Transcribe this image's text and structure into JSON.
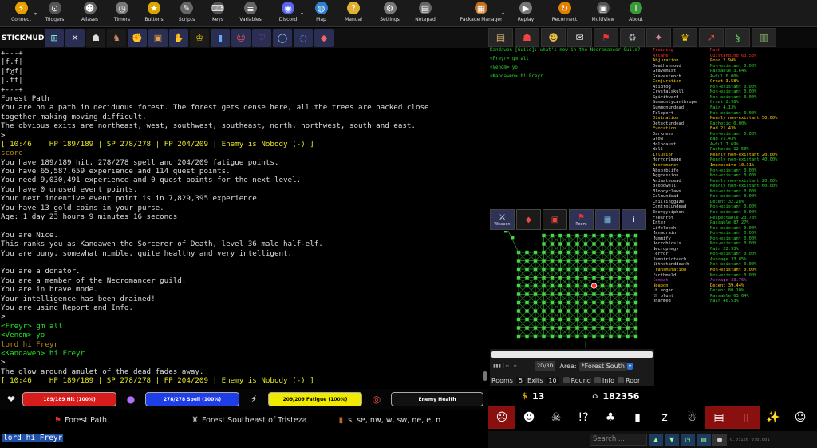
{
  "toolbar": {
    "items": [
      {
        "name": "connect",
        "label": "Connect",
        "glyph": "⚡",
        "color": "#e8a000",
        "arrow": true
      },
      {
        "name": "triggers",
        "label": "Triggers",
        "glyph": "⊙",
        "color": "#555"
      },
      {
        "name": "aliases",
        "label": "Aliases",
        "glyph": "☻",
        "color": "#666"
      },
      {
        "name": "timers",
        "label": "Timers",
        "glyph": "◷",
        "color": "#777"
      },
      {
        "name": "buttons",
        "label": "Buttons",
        "glyph": "★",
        "color": "#d8a800"
      },
      {
        "name": "scripts",
        "label": "Scripts",
        "glyph": "✎",
        "color": "#666"
      },
      {
        "name": "keys",
        "label": "Keys",
        "glyph": "⌨",
        "color": "#555"
      },
      {
        "name": "variables",
        "label": "Variables",
        "glyph": "≣",
        "color": "#666"
      },
      {
        "name": "discord",
        "label": "Discord",
        "glyph": "◉",
        "color": "#5865f2",
        "arrow": true
      },
      {
        "name": "map",
        "label": "Map",
        "glyph": "◍",
        "color": "#2d7fd0"
      },
      {
        "name": "manual",
        "label": "Manual",
        "glyph": "?",
        "color": "#e0b030"
      },
      {
        "name": "settings",
        "label": "Settings",
        "glyph": "⚙",
        "color": "#777"
      },
      {
        "name": "notepad",
        "label": "Notepad",
        "glyph": "▤",
        "color": "#666"
      },
      {
        "name": "package-manager",
        "label": "Package Manager",
        "glyph": "▦",
        "color": "#c07020",
        "arrow": true
      },
      {
        "name": "replay",
        "label": "Replay",
        "glyph": "▶",
        "color": "#777"
      },
      {
        "name": "reconnect",
        "label": "Reconnect",
        "glyph": "↻",
        "color": "#e08000"
      },
      {
        "name": "multiview",
        "label": "MultiView",
        "glyph": "▣",
        "color": "#555"
      },
      {
        "name": "about",
        "label": "About",
        "glyph": "i",
        "color": "#3a9a3a"
      }
    ]
  },
  "mud_name": "STICKMUD",
  "quick_icons": [
    {
      "name": "world-icon",
      "glyph": "⊞",
      "alt": false
    },
    {
      "name": "skills-icon",
      "glyph": "✕",
      "alt": false
    },
    {
      "name": "guild-icon",
      "glyph": "☗",
      "alt": true
    },
    {
      "name": "boots-icon",
      "glyph": "♞",
      "alt": true
    },
    {
      "name": "strength-icon",
      "glyph": "✊",
      "alt": false
    },
    {
      "name": "armor-icon",
      "glyph": "▣",
      "alt": false
    },
    {
      "name": "gloves-icon",
      "glyph": "✋",
      "alt": false
    },
    {
      "name": "crown-icon",
      "glyph": "♔",
      "alt": true
    },
    {
      "name": "legs-icon",
      "glyph": "▮",
      "alt": false
    },
    {
      "name": "mask-icon",
      "glyph": "☺",
      "alt": false
    },
    {
      "name": "amulet-icon",
      "glyph": "♡",
      "alt": false
    },
    {
      "name": "ring-icon",
      "glyph": "◯",
      "alt": false
    },
    {
      "name": "ring2-icon",
      "glyph": "◌",
      "alt": false
    },
    {
      "name": "shield-icon",
      "glyph": "◆",
      "alt": false
    }
  ],
  "console": {
    "lines": [
      {
        "t": "+---+",
        "c": "white"
      },
      {
        "t": "|f.f|",
        "c": "white"
      },
      {
        "t": "|f@f|",
        "c": "white"
      },
      {
        "t": "|.ff|",
        "c": "white"
      },
      {
        "t": "+---+",
        "c": "white"
      },
      {
        "t": "Forest Path",
        "c": "white"
      },
      {
        "t": "You are on a path in deciduous forest. The forest gets dense here, all the trees are packed close",
        "c": "white"
      },
      {
        "t": "together making moving difficult.",
        "c": "white"
      },
      {
        "t": "The obvious exits are northeast, west, southwest, southeast, north, northwest, south and east.",
        "c": "white"
      },
      {
        "t": ">",
        "c": "white"
      },
      {
        "t": "[ 10:46    HP 189/189 | SP 278/278 | FP 204/209 | Enemy is Nobody (-) ]",
        "c": "yellow"
      },
      {
        "t": "score",
        "c": "olive"
      },
      {
        "t": "You have 189/189 hit, 278/278 spell and 204/209 fatigue points.",
        "c": "white"
      },
      {
        "t": "You have 65,587,659 experience and 114 quest points.",
        "c": "white"
      },
      {
        "t": "You need 9,030,491 experience and 0 quest points for the next level.",
        "c": "white"
      },
      {
        "t": "You have 0 unused event points.",
        "c": "white"
      },
      {
        "t": "Your next incentive event point is in 7,829,395 experience.",
        "c": "white"
      },
      {
        "t": "You have 13 gold coins in your purse.",
        "c": "white"
      },
      {
        "t": "Age: 1 day 23 hours 9 minutes 16 seconds",
        "c": "white"
      },
      {
        "t": "",
        "c": "white"
      },
      {
        "t": "You are Nice.",
        "c": "white"
      },
      {
        "t": "This ranks you as Kandawen the Sorcerer of Death, level 36 male half-elf.",
        "c": "white"
      },
      {
        "t": "You are puny, somewhat nimble, quite healthy and very intelligent.",
        "c": "white"
      },
      {
        "t": "",
        "c": "white"
      },
      {
        "t": "You are a donator.",
        "c": "white"
      },
      {
        "t": "You are a member of the Necromancer guild.",
        "c": "white"
      },
      {
        "t": "You are in brave mode.",
        "c": "white"
      },
      {
        "t": "Your intelligence has been drained!",
        "c": "white"
      },
      {
        "t": "You are using Report and Info.",
        "c": "white"
      },
      {
        "t": ">",
        "c": "white"
      },
      {
        "t": "<Freyr> gm all",
        "c": "green"
      },
      {
        "t": "<Venom> yo",
        "c": "green"
      },
      {
        "t": "lord hi Freyr",
        "c": "olive"
      },
      {
        "t": "<Kandawen> hi Freyr",
        "c": "green"
      },
      {
        "t": ">",
        "c": "white"
      },
      {
        "t": "The glow around amulet of the dead fades away.",
        "c": "white"
      },
      {
        "t": "[ 10:46    HP 189/189 | SP 278/278 | FP 204/209 | Enemy is Nobody (-) ]",
        "c": "yellow"
      }
    ]
  },
  "gauges": {
    "hp": {
      "label": "189/189 Hit (100%)",
      "color": "#d81b1b",
      "fill": 1.0
    },
    "sp": {
      "label": "278/278 Spell (100%)",
      "color": "#1e3ee8",
      "fill": 1.0
    },
    "fp": {
      "label": "209/209 Fatigue (100%)",
      "color": "#f0ea00",
      "fill": 1.0
    },
    "enemy": {
      "label": "Enemy Health",
      "color": "#1a1a1a",
      "fill": 0
    }
  },
  "room_info": {
    "room": "Forest Path",
    "area": "Forest Southeast of Tristeza",
    "exits": "s, se, nw, w, sw, ne, e, n"
  },
  "command_input": "lord hi Freyr",
  "right_tabs": [
    {
      "name": "scroll-icon",
      "glyph": "▤"
    },
    {
      "name": "group-icon",
      "glyph": "☗"
    },
    {
      "name": "people-icon",
      "glyph": "☻"
    },
    {
      "name": "chat-icon",
      "glyph": "✉"
    },
    {
      "name": "pin-icon",
      "glyph": "⚑"
    },
    {
      "name": "trash-icon",
      "glyph": "♻"
    },
    {
      "name": "wizard-icon",
      "glyph": "✦"
    },
    {
      "name": "trophy-icon",
      "glyph": "♛"
    },
    {
      "name": "graph-icon",
      "glyph": "↗"
    },
    {
      "name": "snake-icon",
      "glyph": "§"
    },
    {
      "name": "books-icon",
      "glyph": "▥"
    }
  ],
  "chat": {
    "lines": [
      "Kandawen [Guild]: what's new in the Necromancer Guild?",
      "<Freyr> gm all",
      "<Venom> yo",
      "<Kandawen> hi Freyr"
    ]
  },
  "skills": {
    "rows": [
      {
        "n": "Training",
        "v": "Rank",
        "nc": "#ff3030",
        "vc": "#ff3030"
      },
      {
        "n": "Arcane",
        "v": "Outstanding 63.58%",
        "nc": "#ff3030",
        "vc": "#ff3030"
      },
      {
        "n": " Abjuration",
        "v": "Poor 2.94%",
        "nc": "#ffd200",
        "vc": "#ffd200"
      },
      {
        "n": "  Deathshroud",
        "v": "Non-existant 0.00%",
        "nc": "#ddd",
        "vc": "#2fd22f"
      },
      {
        "n": "  Gravemist",
        "v": "Passable 3.64%",
        "nc": "#ddd",
        "vc": "#2fd22f"
      },
      {
        "n": "  Gravestench",
        "v": "Awful 0.00%",
        "nc": "#ddd",
        "vc": "#2fd22f"
      },
      {
        "n": " Conjuration",
        "v": "Great 3.58%",
        "nc": "#ffd200",
        "vc": "#ffd200"
      },
      {
        "n": "  Acidfog",
        "v": "Non-existant 0.00%",
        "nc": "#ddd",
        "vc": "#2fd22f"
      },
      {
        "n": "  Crystalskull",
        "v": "Non-existant 0.00%",
        "nc": "#ddd",
        "vc": "#2fd22f"
      },
      {
        "n": "  Spiritward",
        "v": "Non-existant 0.00%",
        "nc": "#ddd",
        "vc": "#2fd22f"
      },
      {
        "n": "  Summonlycanthrope",
        "v": "Great 2.98%",
        "nc": "#ddd",
        "vc": "#2fd22f"
      },
      {
        "n": "  Summonundead",
        "v": "Fair 4.13%",
        "nc": "#ddd",
        "vc": "#2fd22f"
      },
      {
        "n": "  Teleport",
        "v": "Non-existant 0.00%",
        "nc": "#ddd",
        "vc": "#2fd22f"
      },
      {
        "n": " Divination",
        "v": "Nearly non-existant 50.00%",
        "nc": "#ffd200",
        "vc": "#ffd200"
      },
      {
        "n": "  Detectundead",
        "v": "Pathetic 0.00%",
        "nc": "#ddd",
        "vc": "#2fd22f"
      },
      {
        "n": " Evocation",
        "v": "Bad 21.43%",
        "nc": "#ffd200",
        "vc": "#ffd200"
      },
      {
        "n": "  Darkness",
        "v": "Non-existant 0.00%",
        "nc": "#ddd",
        "vc": "#2fd22f"
      },
      {
        "n": "  Glow",
        "v": "Bad 71.43%",
        "nc": "#ddd",
        "vc": "#2fd22f"
      },
      {
        "n": "  Holocaust",
        "v": "Awful 7.69%",
        "nc": "#ddd",
        "vc": "#2fd22f"
      },
      {
        "n": "  Wall",
        "v": "Pathetic 12.50%",
        "nc": "#ddd",
        "vc": "#2fd22f"
      },
      {
        "n": " Illusion",
        "v": "Nearly non-existant 20.00%",
        "nc": "#ffd200",
        "vc": "#ffd200"
      },
      {
        "n": "  Horrorimage",
        "v": "Nearly non-existant 40.00%",
        "nc": "#ddd",
        "vc": "#2fd22f"
      },
      {
        "n": " Necromancy",
        "v": "Impressive 10.31%",
        "nc": "#ffd200",
        "vc": "#ffd200"
      },
      {
        "n": "  Absorblife",
        "v": "Non-existant 0.00%",
        "nc": "#ddd",
        "vc": "#2fd22f"
      },
      {
        "n": "  Aggression",
        "v": "Non-existant 0.00%",
        "nc": "#ddd",
        "vc": "#2fd22f"
      },
      {
        "n": "  Animatedead",
        "v": "Nearly non-existant 20.00%",
        "nc": "#ddd",
        "vc": "#2fd22f"
      },
      {
        "n": "  Bloodwell",
        "v": "Nearly non-existant 60.00%",
        "nc": "#ddd",
        "vc": "#2fd22f"
      },
      {
        "n": "  Bloodyclaws",
        "v": "Non-existant 0.00%",
        "nc": "#ddd",
        "vc": "#2fd22f"
      },
      {
        "n": "  Calmundead",
        "v": "Non-existant 0.00%",
        "nc": "#ddd",
        "vc": "#2fd22f"
      },
      {
        "n": "  Chillinggaze",
        "v": "Decent 32.28%",
        "nc": "#ddd",
        "vc": "#2fd22f"
      },
      {
        "n": "  Controlundead",
        "v": "Non-existant 0.00%",
        "nc": "#ddd",
        "vc": "#2fd22f"
      },
      {
        "n": "  Energysiphon",
        "v": "Non-existant 0.00%",
        "nc": "#ddd",
        "vc": "#2fd22f"
      },
      {
        "n": "  Fleshrot",
        "v": "Respectable 23.78%",
        "nc": "#ddd",
        "vc": "#2fd22f"
      },
      {
        "n": "  Inter",
        "v": "Passable 87.27%",
        "nc": "#ddd",
        "vc": "#2fd22f"
      },
      {
        "n": "  Lifeleech",
        "v": "Non-existant 0.00%",
        "nc": "#ddd",
        "vc": "#2fd22f"
      },
      {
        "n": "  Manadrain",
        "v": "Non-existant 0.00%",
        "nc": "#ddd",
        "vc": "#2fd22f"
      },
      {
        "n": "  Mummify",
        "v": "Non-existant 0.00%",
        "nc": "#ddd",
        "vc": "#2fd22f"
      },
      {
        "n": "  Necrobiosis",
        "v": "Non-existant 0.00%",
        "nc": "#ddd",
        "vc": "#2fd22f"
      },
      {
        "n": "  Necrophagy",
        "v": "Fair 22.93%",
        "nc": "#ddd",
        "vc": "#2fd22f"
      },
      {
        "n": "  Terror",
        "v": "Non-existant 0.00%",
        "nc": "#ddd",
        "vc": "#2fd22f"
      },
      {
        "n": "  Vampirictouch",
        "v": "Average 33.85%",
        "nc": "#ddd",
        "vc": "#2fd22f"
      },
      {
        "n": "  Withstanddeath",
        "v": "Non-existant 0.00%",
        "nc": "#ddd",
        "vc": "#2fd22f"
      },
      {
        "n": " Transmutation",
        "v": "Non-existant 0.00%",
        "nc": "#ffd200",
        "vc": "#ffd200"
      },
      {
        "n": "  Earthmeld",
        "v": "Non-existant 0.00%",
        "nc": "#ddd",
        "vc": "#2fd22f"
      },
      {
        "n": "Combat",
        "v": "Average 33.76%",
        "nc": "#d040d0",
        "vc": "#d040d0"
      },
      {
        "n": " Weapon",
        "v": "Decent 39.44%",
        "nc": "#ffd200",
        "vc": "#ffd200"
      },
      {
        "n": "  1h edged",
        "v": "Decent 80.10%",
        "nc": "#ddd",
        "vc": "#2fd22f"
      },
      {
        "n": "  2h blunt",
        "v": "Passable 63.64%",
        "nc": "#ddd",
        "vc": "#2fd22f"
      },
      {
        "n": "  Unarmed",
        "v": "Fair 46.53%",
        "nc": "#ddd",
        "vc": "#2fd22f"
      }
    ]
  },
  "map_buttons": [
    {
      "name": "weapon-button",
      "glyph": "⚔",
      "label": "Weapon"
    },
    {
      "name": "shield-button",
      "glyph": "◆",
      "label": ""
    },
    {
      "name": "bag-button",
      "glyph": "▣",
      "label": ""
    },
    {
      "name": "room-button",
      "glyph": "⚑",
      "label": "Room"
    },
    {
      "name": "worldmap-button",
      "glyph": "▦",
      "label": ""
    },
    {
      "name": "info-button",
      "glyph": "i",
      "label": ""
    }
  ],
  "map_controls": {
    "mode": "2D/3D",
    "area_label": "Area:",
    "area_value": "*Forest South",
    "rooms_label": "Rooms",
    "rooms_value": "5",
    "exits_label": "Exits",
    "exits_value": "10",
    "round_label": "Round",
    "info_label": "Info",
    "room_label": "Roor"
  },
  "stats": {
    "gold": "13",
    "bank": "182356"
  },
  "emotes": [
    {
      "name": "scream-icon",
      "glyph": "☹",
      "red": true
    },
    {
      "name": "devil-icon",
      "glyph": "☻",
      "red": false
    },
    {
      "name": "skull-icon",
      "glyph": "☠",
      "red": false
    },
    {
      "name": "exclaim-icon",
      "glyph": "!?",
      "red": false
    },
    {
      "name": "mushroom-icon",
      "glyph": "♣",
      "red": false
    },
    {
      "name": "beer-icon",
      "glyph": "▮",
      "red": false
    },
    {
      "name": "sleep-icon",
      "glyph": "z",
      "red": false
    },
    {
      "name": "ghost-icon",
      "glyph": "☃",
      "red": false
    },
    {
      "name": "bread-icon",
      "glyph": "▤",
      "red": true
    },
    {
      "name": "milk-icon",
      "glyph": "▯",
      "red": true
    },
    {
      "name": "sparkle-icon",
      "glyph": "✨",
      "red": false
    },
    {
      "name": "frog-icon",
      "glyph": "☺",
      "red": false
    }
  ],
  "bottom": {
    "search_placeholder": "Search ...",
    "timer": "0.0:126 0:0.001"
  }
}
